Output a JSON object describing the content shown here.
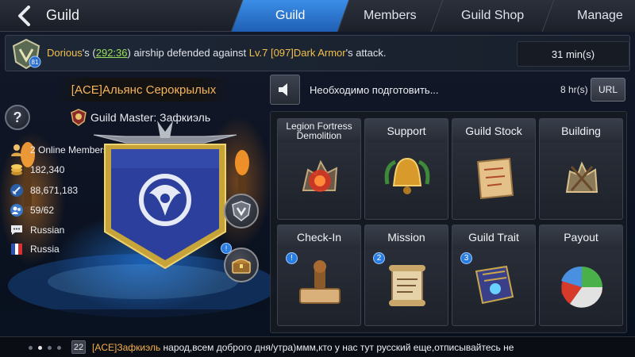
{
  "header": {
    "title": "Guild",
    "tabs": [
      {
        "label": "Guild",
        "active": true
      },
      {
        "label": "Members",
        "active": false
      },
      {
        "label": "Guild Shop",
        "active": false
      },
      {
        "label": "Manage",
        "active": false
      }
    ]
  },
  "notice": {
    "player": "Dorious",
    "possessive": "'s (",
    "coords": "292:36",
    "mid": ") airship defended against ",
    "level": "Lv.7",
    "enemy": "[097]Dark Armor",
    "tail": "'s attack.",
    "emblem_level": "81",
    "time": "31 min(s)"
  },
  "guild": {
    "name": "[ACE]Альянс Серокрылых",
    "master_label": "Guild Master: Зафкиэль",
    "online": "2 Online Members",
    "power": "182,340",
    "funds": "88,671,183",
    "members": "59/62",
    "language": "Russian",
    "country": "Russia"
  },
  "announcement": {
    "text": "Необходимо подготовить...",
    "time": "8 hr(s)",
    "url_label": "URL"
  },
  "grid": [
    {
      "title": "Legion Fortress Demolition",
      "icon": "fortress-demolition-icon",
      "badge": ""
    },
    {
      "title": "Support",
      "icon": "bell-support-icon",
      "badge": ""
    },
    {
      "title": "Guild Stock",
      "icon": "map-scroll-icon",
      "badge": ""
    },
    {
      "title": "Building",
      "icon": "building-construction-icon",
      "badge": ""
    },
    {
      "title": "Check-In",
      "icon": "stamp-checkin-icon",
      "badge": "!"
    },
    {
      "title": "Mission",
      "icon": "mission-scroll-icon",
      "badge": "2"
    },
    {
      "title": "Guild Trait",
      "icon": "trait-book-icon",
      "badge": "3"
    },
    {
      "title": "Payout",
      "icon": "pie-payout-icon",
      "badge": ""
    }
  ],
  "chat": {
    "level": "22",
    "sender": "[ACE]Зафкиэль",
    "message": " народ,всем доброго дня/утра)ммм,кто у нас тут русский еще,отписывайтесь не"
  },
  "colors": {
    "active_tab": "#2f7bd8",
    "gold_text": "#f2c04a",
    "coord_green": "#9be05a",
    "guild_name": "#f7b45a",
    "badge_blue": "#2a7de0"
  }
}
